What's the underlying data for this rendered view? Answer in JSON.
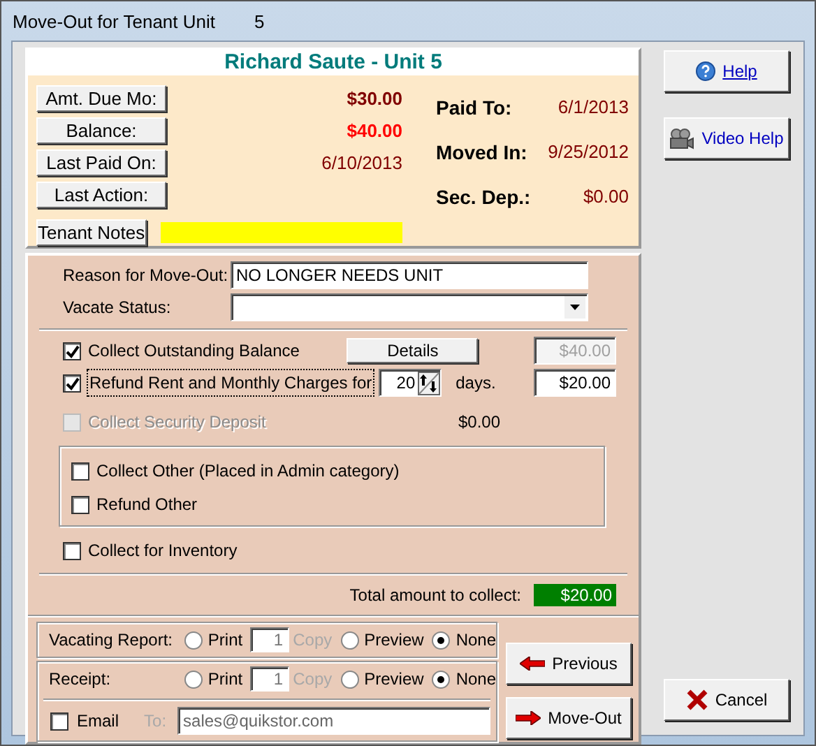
{
  "window": {
    "title": "Move-Out for Tenant Unit",
    "unit": "5"
  },
  "tenant_header": "Richard Saute - Unit 5",
  "summary_left": [
    {
      "button": "Amt. Due Mo:",
      "value": "$30.00",
      "color": "#800000",
      "bold": true
    },
    {
      "button": "Balance:",
      "value": "$40.00",
      "color": "#ff0000",
      "bold": true
    },
    {
      "button": "Last Paid On:",
      "value": "6/10/2013",
      "color": "#800000",
      "bold": false
    },
    {
      "button": "Last Action:"
    }
  ],
  "summary_right": [
    {
      "label": "Paid To:",
      "value": "6/1/2013"
    },
    {
      "label": "Moved In:",
      "value": "9/25/2012"
    },
    {
      "label": "Sec. Dep.:",
      "value": "$0.00"
    }
  ],
  "notes_button": "Tenant Notes",
  "reason": {
    "label": "Reason for Move-Out:",
    "value": "NO LONGER NEEDS UNIT"
  },
  "vacate_status": {
    "label": "Vacate Status:"
  },
  "charges": [
    {
      "kind": "details",
      "label": "Collect Outstanding Balance",
      "checked": true,
      "disabled": false,
      "button": "Details",
      "amount": "$40.00",
      "amount_disabled": true
    },
    {
      "kind": "days",
      "label": "Refund Rent and Monthly Charges for",
      "checked": true,
      "disabled": false,
      "days": "20",
      "days_label": "days.",
      "amount": "$20.00",
      "amount_disabled": false
    },
    {
      "kind": "plain",
      "label": "Collect Security Deposit",
      "checked": false,
      "disabled": true,
      "amount": "$0.00"
    }
  ],
  "other": [
    {
      "label": "Collect Other (Placed in Admin category)",
      "checked": false
    },
    {
      "label": "Refund Other",
      "checked": false
    }
  ],
  "inventory": {
    "label": "Collect for Inventory",
    "checked": false
  },
  "total": {
    "label": "Total amount to collect:",
    "value": "$20.00"
  },
  "reports": [
    {
      "label": "Vacating Report:",
      "copies": "1",
      "copy_label": "Copy",
      "options": [
        {
          "label": "Print",
          "selected": false
        },
        {
          "label": "Preview",
          "selected": false
        },
        {
          "label": "None",
          "selected": true
        }
      ]
    },
    {
      "label": "Receipt:",
      "copies": "1",
      "copy_label": "Copy",
      "options": [
        {
          "label": "Print",
          "selected": false
        },
        {
          "label": "Preview",
          "selected": false
        },
        {
          "label": "None",
          "selected": true
        }
      ]
    }
  ],
  "email": {
    "label": "Email",
    "checked": false,
    "to_label": "To:",
    "value": "sales@quikstor.com"
  },
  "buttons": {
    "help": "Help",
    "video_help": "Video Help",
    "previous": "Previous",
    "move_out": "Move-Out",
    "cancel": "Cancel"
  }
}
